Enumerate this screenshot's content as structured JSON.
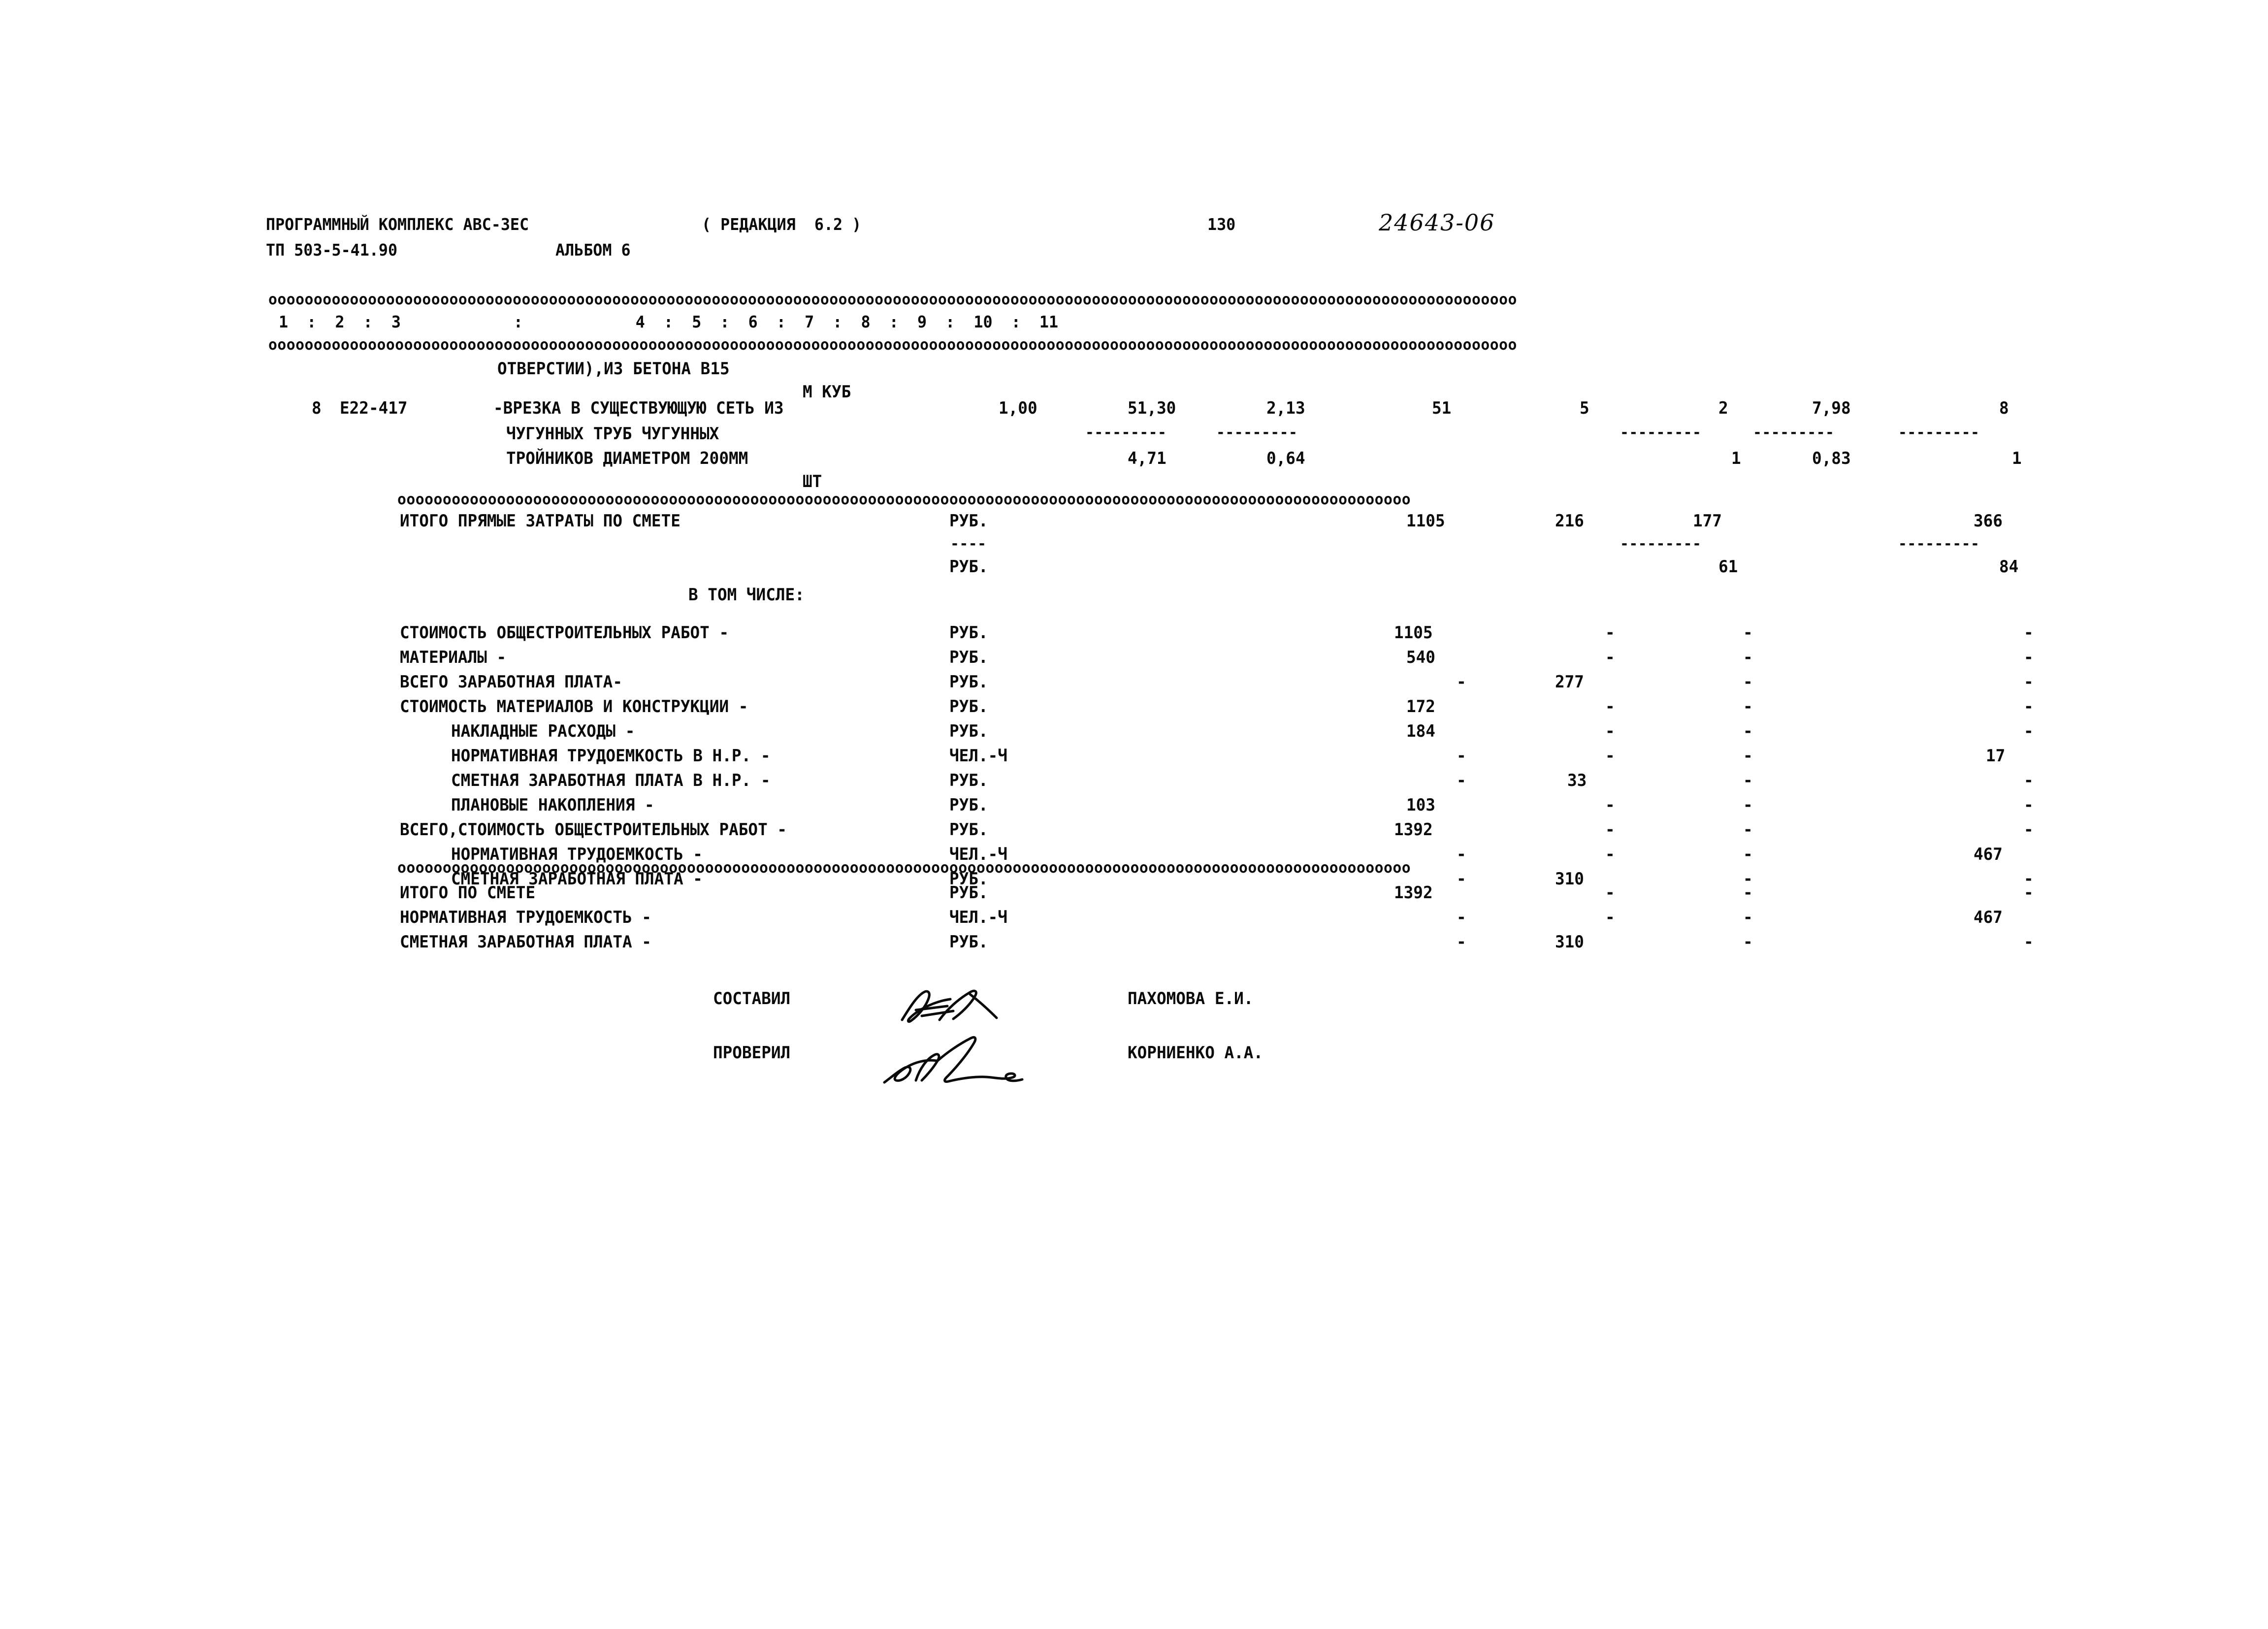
{
  "document": {
    "kind": "construction-cost-estimate-printout",
    "header": {
      "program_line": "ПРОГРАММНЫЙ КОМПЛЕКС АВС-ЗЕС",
      "revision": "( РЕДАКЦИЯ  6.2 )",
      "project_line": "ТП 503-5-41.90",
      "album": "АЛЬБОМ 6",
      "page_number": "130",
      "handwritten_code": "24643-06"
    },
    "column_header": {
      "numbers": [
        "1",
        "2",
        "3",
        "4",
        "5",
        "6",
        "7",
        "8",
        "9",
        "10",
        "11"
      ],
      "separator_char": ":",
      "raw": "1  :  2  :            3            :  4  :  5  :  6  :  7  :  8  :  9  :  10  :  11"
    },
    "separators": {
      "char": "o",
      "full_rule_chars": 138,
      "dash_char": "-"
    },
    "work_item": {
      "continuation_line": "ОТВЕРСТИИ),ИЗ БЕТОНА В15",
      "continuation_unit": "М КУБ",
      "number": "8",
      "code": "Е22-417",
      "description_lines": [
        "-ВРЕЗКА В СУЩЕСТВУЮЩУЮ СЕТЬ ИЗ",
        "ЧУГУННЫХ ТРУБ ЧУГУННЫХ",
        "ТРОЙНИКОВ ДИАМЕТРОМ 200ММ"
      ],
      "unit": "ШТ",
      "values_top": {
        "col4_quantity": "1,00",
        "col5": "51,30",
        "col6": "2,13",
        "col7": "51",
        "col8": "5",
        "col9": "2",
        "col10": "7,98",
        "col11": "8"
      },
      "values_bottom": {
        "col5": "4,71",
        "col6": "0,64",
        "col9": "1",
        "col10": "0,83",
        "col11": "1"
      }
    },
    "direct_costs": {
      "label": "ИТОГО ПРЯМЫЕ ЗАТРАТЫ ПО СМЕТЕ",
      "unit": "РУБ.",
      "values": {
        "col7": "1105",
        "col8": "216",
        "col9": "177",
        "col11": "366"
      },
      "sub_unit": "РУБ.",
      "sub_values": {
        "col9": "61",
        "col11": "84"
      }
    },
    "in_that_number_label": "В ТОМ ЧИСЛЕ:",
    "breakdown_rows": [
      {
        "label": "СТОИМОСТЬ ОБЩЕСТРОИТЕЛЬНЫХ РАБОТ -",
        "indent": 0,
        "unit": "РУБ.",
        "col7": "1105",
        "col8": "-",
        "col9": "-",
        "col11": "-"
      },
      {
        "label": "МАТЕРИАЛЫ -",
        "indent": 0,
        "unit": "РУБ.",
        "col7": "540",
        "col8": "-",
        "col9": "-",
        "col11": "-"
      },
      {
        "label": "ВСЕГО ЗАРАБОТНАЯ ПЛАТА-",
        "indent": 0,
        "unit": "РУБ.",
        "col7": "-",
        "col8": "277",
        "col9": "-",
        "col11": "-"
      },
      {
        "label": "СТОИМОСТЬ МАТЕРИАЛОВ И КОНСТРУКЦИИ -",
        "indent": 0,
        "unit": "РУБ.",
        "col7": "172",
        "col8": "-",
        "col9": "-",
        "col11": "-"
      },
      {
        "label": "НАКЛАДНЫЕ РАСХОДЫ -",
        "indent": 2,
        "unit": "РУБ.",
        "col7": "184",
        "col8": "-",
        "col9": "-",
        "col11": "-"
      },
      {
        "label": "НОРМАТИВНАЯ ТРУДОЕМКОСТЬ В Н.Р. -",
        "indent": 2,
        "unit": "ЧЕЛ.-Ч",
        "col7": "-",
        "col8": "-",
        "col9": "-",
        "col11": "17"
      },
      {
        "label": "СМЕТНАЯ ЗАРАБОТНАЯ ПЛАТА В Н.Р. -",
        "indent": 2,
        "unit": "РУБ.",
        "col7": "-",
        "col8": "33",
        "col9": "-",
        "col11": "-"
      },
      {
        "label": "ПЛАНОВЫЕ НАКОПЛЕНИЯ -",
        "indent": 2,
        "unit": "РУБ.",
        "col7": "103",
        "col8": "-",
        "col9": "-",
        "col11": "-"
      },
      {
        "label": "ВСЕГО,СТОИМОСТЬ ОБЩЕСТРОИТЕЛЬНЫХ РАБОТ -",
        "indent": 0,
        "unit": "РУБ.",
        "col7": "1392",
        "col8": "-",
        "col9": "-",
        "col11": "-"
      },
      {
        "label": "НОРМАТИВНАЯ ТРУДОЕМКОСТЬ -",
        "indent": 2,
        "unit": "ЧЕЛ.-Ч",
        "col7": "-",
        "col8": "-",
        "col9": "-",
        "col11": "467"
      },
      {
        "label": "СМЕТНАЯ ЗАРАБОТНАЯ ПЛАТА -",
        "indent": 2,
        "unit": "РУБ.",
        "col7": "-",
        "col8": "310",
        "col9": "-",
        "col11": "-"
      }
    ],
    "totals_rows": [
      {
        "label": "ИТОГО ПО СМЕТЕ",
        "indent": 0,
        "unit": "РУБ.",
        "col7": "1392",
        "col8": "-",
        "col9": "-",
        "col11": "-"
      },
      {
        "label": "НОРМАТИВНАЯ ТРУДОЕМКОСТЬ -",
        "indent": 0,
        "unit": "ЧЕЛ.-Ч",
        "col7": "-",
        "col8": "-",
        "col9": "-",
        "col11": "467"
      },
      {
        "label": "СМЕТНАЯ ЗАРАБОТНАЯ ПЛАТА -",
        "indent": 0,
        "unit": "РУБ.",
        "col7": "-",
        "col8": "310",
        "col9": "-",
        "col11": "-"
      }
    ],
    "signatures": [
      {
        "role": "СОСТАВИЛ",
        "name": "ПАХОМОВА Е.И."
      },
      {
        "role": "ПРОВЕРИЛ",
        "name": "КОРНИЕНКО А.А."
      }
    ],
    "colors": {
      "ink": "#0a0a0a",
      "paper": "#ffffff"
    }
  }
}
